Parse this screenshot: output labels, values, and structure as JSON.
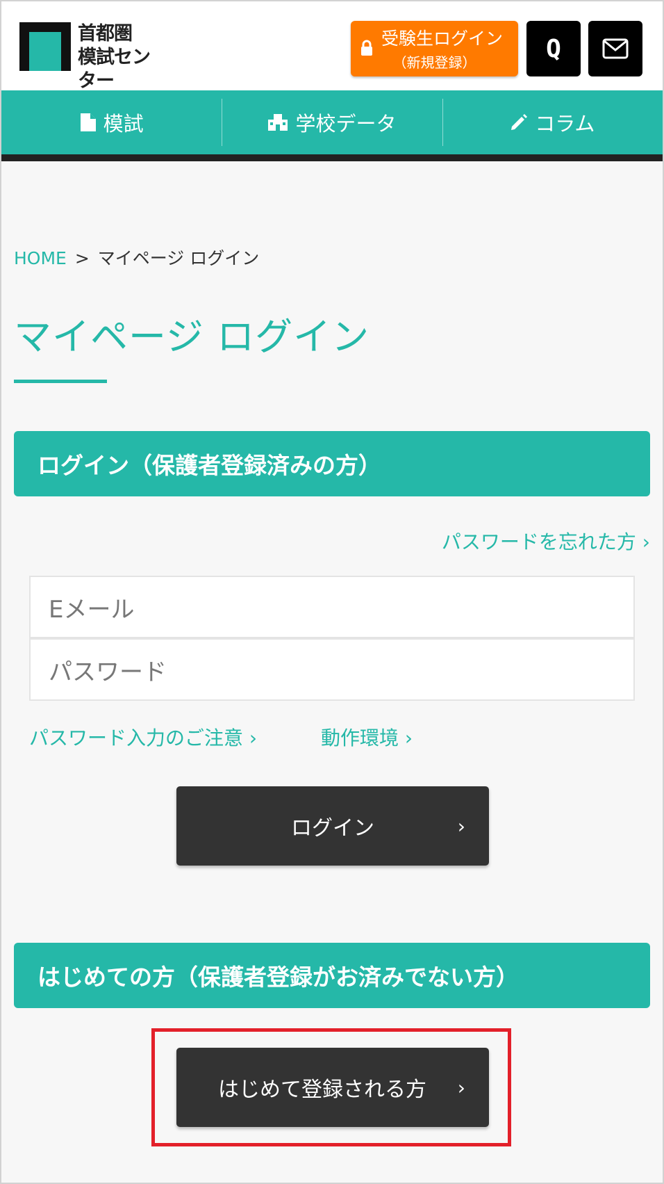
{
  "header": {
    "logo_line1": "首都圏",
    "logo_line2": "模試センター",
    "exam_login_label": "受験生ログイン",
    "exam_login_sub": "（新規登録）",
    "q_label": "Q"
  },
  "nav": {
    "items": [
      {
        "label": "模試",
        "icon": "document-icon"
      },
      {
        "label": "学校データ",
        "icon": "school-icon"
      },
      {
        "label": "コラム",
        "icon": "pencil-icon"
      }
    ]
  },
  "breadcrumb": {
    "home": "HOME",
    "separator": ">",
    "current": "マイページ ログイン"
  },
  "page_title": "マイページ ログイン",
  "login_section": {
    "heading": "ログイン（保護者登録済みの方）",
    "forgot_password": "パスワードを忘れた方 ›",
    "email_placeholder": "Eメール",
    "password_placeholder": "パスワード",
    "password_note_link": "パスワード入力のご注意 ›",
    "environment_link": "動作環境 ›",
    "login_button": "ログイン",
    "chevron": "›"
  },
  "register_section": {
    "heading": "はじめての方（保護者登録がお済みでない方）",
    "register_button": "はじめて登録される方",
    "chevron": "›"
  },
  "colors": {
    "accent": "#25b8a8",
    "orange": "#ff7a00",
    "dark_button": "#333333",
    "highlight": "#e3202a"
  }
}
